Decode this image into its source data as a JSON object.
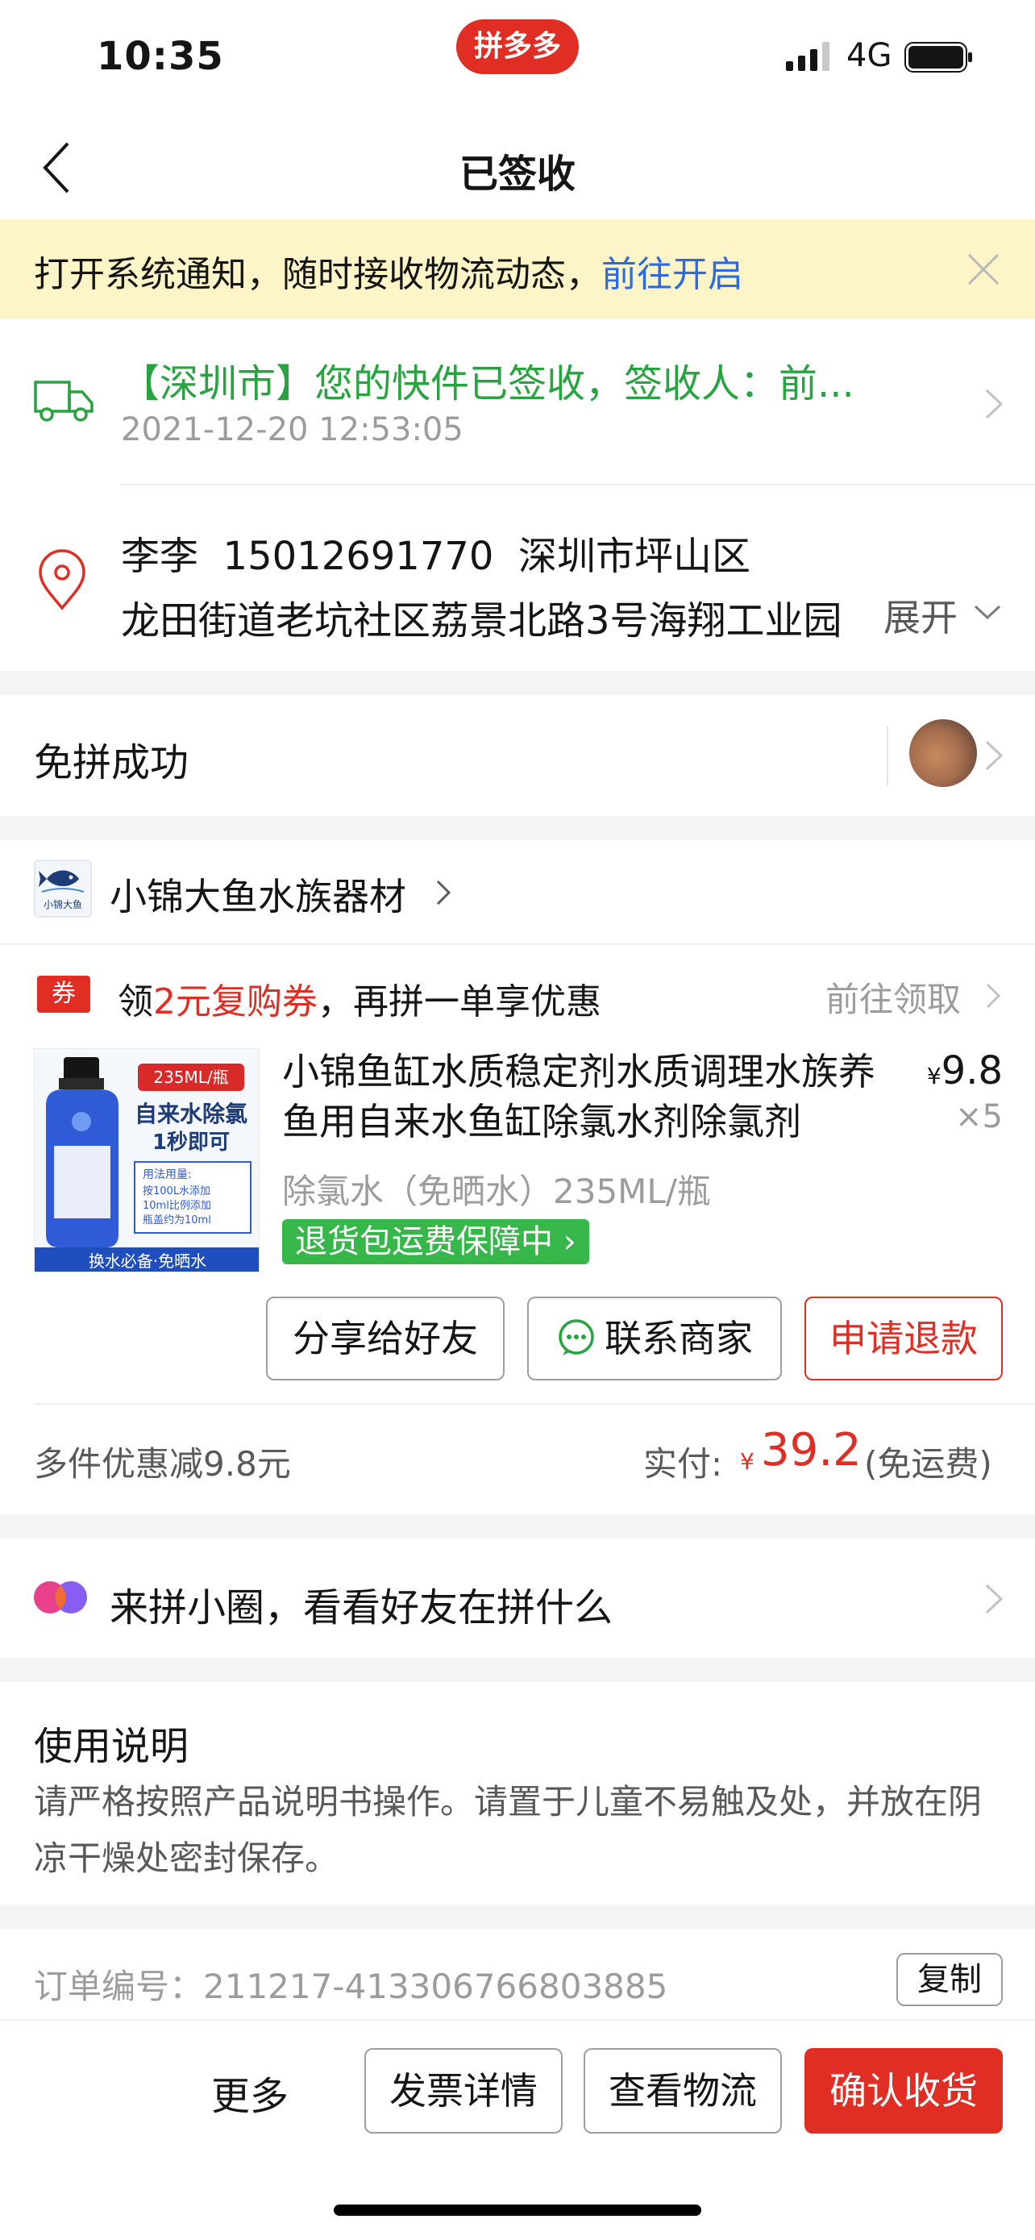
{
  "status_bar": {
    "time": "10:35",
    "app_badge": "拼多多",
    "network": "4G"
  },
  "nav": {
    "title": "已签收",
    "back_icon": "chevron-left-icon"
  },
  "notice": {
    "text": "打开系统通知，随时接收物流动态，",
    "link": "前往开启"
  },
  "logistics": {
    "title": "【深圳市】您的快件已签收，签收人：前...",
    "time": "2021-12-20 12:53:05"
  },
  "address": {
    "name": "李李",
    "phone": "15012691770",
    "district": "深圳市坪山区",
    "line2": "龙田街道老坑社区荔景北路3号海翔工业园",
    "expand": "展开"
  },
  "group": {
    "status": "免拼成功"
  },
  "shop": {
    "name": "小锦大鱼水族器材",
    "logo_text": "小锦大鱼"
  },
  "coupon": {
    "badge": "券",
    "prefix": "领",
    "amount": "2元复购券",
    "suffix": "，再拼一单享优惠",
    "link": "前往领取"
  },
  "product": {
    "title": "小锦鱼缸水质稳定剂水质调理水族养鱼用自来水鱼缸除氯水剂除氯剂",
    "price_symbol": "¥",
    "price": "9.8",
    "quantity": "×5",
    "spec": "除氯水（免晒水）235ML/瓶",
    "guarantee": "退货包运费保障中",
    "image": {
      "tag": "235ML/瓶",
      "headline1": "自来水除氯",
      "headline2": "1秒即可",
      "usage_title": "用法用量:",
      "usage_lines": [
        "按100L水添加",
        "10ml比例添加",
        "瓶盖约为10ml"
      ],
      "footer": "换水必备·免晒水"
    }
  },
  "actions": {
    "share": "分享给好友",
    "contact": "联系商家",
    "refund": "申请退款"
  },
  "payment": {
    "discount": "多件优惠减9.8元",
    "paid_label": "实付:",
    "currency": "¥",
    "amount": "39.2",
    "shipping": "(免运费)"
  },
  "community": {
    "text": "来拼小圈，看看好友在拼什么"
  },
  "usage": {
    "title": "使用说明",
    "text": "请严格按照产品说明书操作。请置于儿童不易触及处，并放在阴凉干燥处密封保存。"
  },
  "order": {
    "label": "订单编号：",
    "number": "211217-413306766803885",
    "copy": "复制"
  },
  "bottom_bar": {
    "more": "更多",
    "invoice": "发票详情",
    "view_logistics": "查看物流",
    "confirm": "确认收货"
  },
  "colors": {
    "brand_red": "#e02e24",
    "success_green": "#27a340",
    "link_blue": "#2b6ae6",
    "notice_bg": "#fdf5c8"
  }
}
